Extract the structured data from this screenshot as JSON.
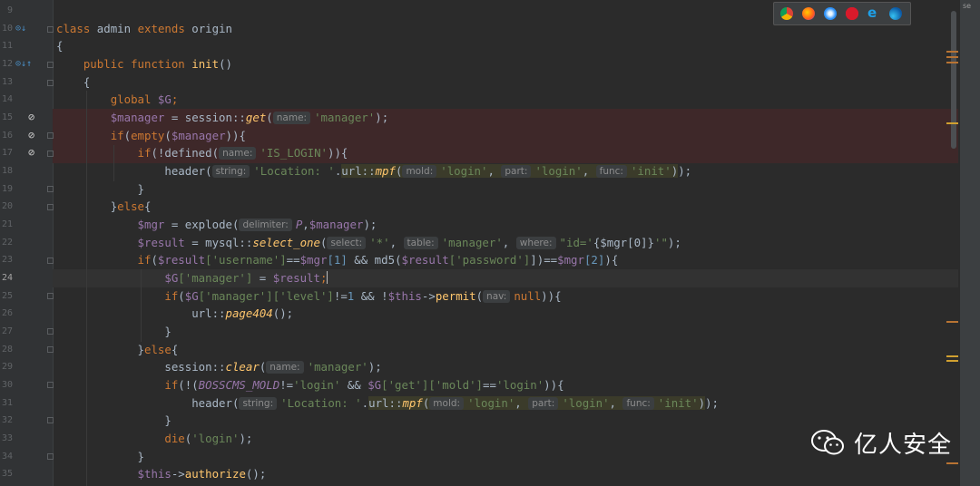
{
  "editor": {
    "line_numbers": [
      "9",
      "10",
      "11",
      "12",
      "13",
      "14",
      "15",
      "16",
      "17",
      "18",
      "19",
      "20",
      "21",
      "22",
      "23",
      "24",
      "25",
      "26",
      "27",
      "28",
      "29",
      "30",
      "31",
      "32",
      "33",
      "34",
      "35"
    ],
    "current_line": "24"
  },
  "code": {
    "l10": {
      "kw": "class",
      "name": "admin",
      "kw2": "extends",
      "parent": "origin"
    },
    "l11": "{",
    "l12": {
      "kw": "public",
      "kw2": "function",
      "name": "init",
      "rest": "()"
    },
    "l13": "{",
    "l14": {
      "kw": "global",
      "var": "$G",
      "semi": ";"
    },
    "l15": {
      "var": "$manager",
      "op": " = session::",
      "fn": "get",
      "open": "(",
      "hint": "name:",
      "str": "'manager'",
      "close": ");"
    },
    "l16": {
      "kw": "if",
      "p": "(",
      "kw2": "empty",
      "p2": "(",
      "var": "$manager",
      "close": ")){"
    },
    "l17": {
      "kw": "if",
      "p": "(!",
      "fn": "defined",
      "open": "(",
      "hint": "name:",
      "str": "'IS_LOGIN'",
      "close": ")){"
    },
    "l18": {
      "fn": "header",
      "open": "(",
      "hint": "string:",
      "str": "'Location: '",
      "dot": ".",
      "cls": "url::",
      "m": "mpf",
      "open2": "(",
      "h1": "mold:",
      "s1": "'login'",
      "c1": ",",
      "h2": "part:",
      "s2": "'login'",
      "c2": ",",
      "h3": "func:",
      "s3": "'init'",
      "close2": ")",
      "close": ");"
    },
    "l19": "}",
    "l20": {
      "b": "}",
      "kw": "else",
      "o": "{"
    },
    "l21": {
      "var": "$mgr",
      "op": " = ",
      "fn": "explode",
      "open": "(",
      "hint": "delimiter:",
      "p": "P",
      "comma": ",",
      "var2": "$manager",
      "close": ");"
    },
    "l22": {
      "var": "$result",
      "op": " = mysql::",
      "fn": "select_one",
      "open": "(",
      "h1": "select:",
      "s1": "'*'",
      "c1": ",",
      "h2": "table:",
      "s2": "'manager'",
      "c2": ",",
      "h3": "where:",
      "s3a": "\"id='",
      "s3b": "{$mgr[0]}",
      "s3c": "'\"",
      "close": ");"
    },
    "l23": {
      "kw": "if",
      "p": "(",
      "v1": "$result",
      "s1": "['username']",
      "eq": "==",
      "v2": "$mgr",
      "n1": "[1]",
      "and": " && ",
      "fn": "md5",
      "p2": "(",
      "v3": "$result",
      "s2": "['password']",
      "eq2": "])==",
      "v4": "$mgr",
      "n2": "[2]",
      "close": "){"
    },
    "l24": {
      "var": "$G",
      "s": "['manager']",
      "op": " = ",
      "var2": "$result",
      "semi": ";"
    },
    "l25": {
      "kw": "if",
      "p": "(",
      "var": "$G",
      "s1": "['manager']",
      "s2": "['level']",
      "op": "!=",
      "n": "1",
      "and": " && !",
      "this": "$this",
      "arrow": "->",
      "fn": "permit",
      "open": "(",
      "hint": "nav:",
      "nul": "null",
      "close": ")){"
    },
    "l26": {
      "cls": "url::",
      "fn": "page404",
      "close": "();"
    },
    "l27": "}",
    "l28": {
      "b": "}",
      "kw": "else",
      "o": "{"
    },
    "l29": {
      "cls": "session::",
      "fn": "clear",
      "open": "(",
      "hint": "name:",
      "str": "'manager'",
      "close": ");"
    },
    "l30": {
      "kw": "if",
      "p": "(!(",
      "c": "BOSSCMS_MOLD",
      "op": "!=",
      "s1": "'login'",
      "and": " && ",
      "var": "$G",
      "s2": "['get']",
      "s3": "['mold']",
      "eq": "==",
      "s4": "'login'",
      "close": ")){"
    },
    "l31": {
      "fn": "header",
      "open": "(",
      "hint": "string:",
      "str": "'Location: '",
      "dot": ".",
      "cls": "url::",
      "m": "mpf",
      "open2": "(",
      "h1": "mold:",
      "s1": "'login'",
      "c1": ",",
      "h2": "part:",
      "s2": "'login'",
      "c2": ",",
      "h3": "func:",
      "s3": "'init'",
      "close2": ")",
      "close": ");"
    },
    "l32": "}",
    "l33": {
      "kw": "die",
      "p": "(",
      "s": "'login'",
      "close": ");"
    },
    "l34": "}",
    "l35": {
      "this": "$this",
      "arrow": "->",
      "fn": "authorize",
      "close": "();"
    }
  },
  "browser_icons": [
    "chrome-icon",
    "firefox-icon",
    "safari-icon",
    "opera-icon",
    "ie-icon",
    "edge-icon"
  ],
  "right_strip_label": "se",
  "watermark": {
    "text": "亿人安全"
  },
  "colors": {
    "background": "#2b2b2b",
    "gutter": "#313335",
    "keyword": "#cc7832",
    "function": "#ffc66d",
    "variable": "#9876aa",
    "string": "#6a8759",
    "breakpoint_line": "#3e2829"
  }
}
